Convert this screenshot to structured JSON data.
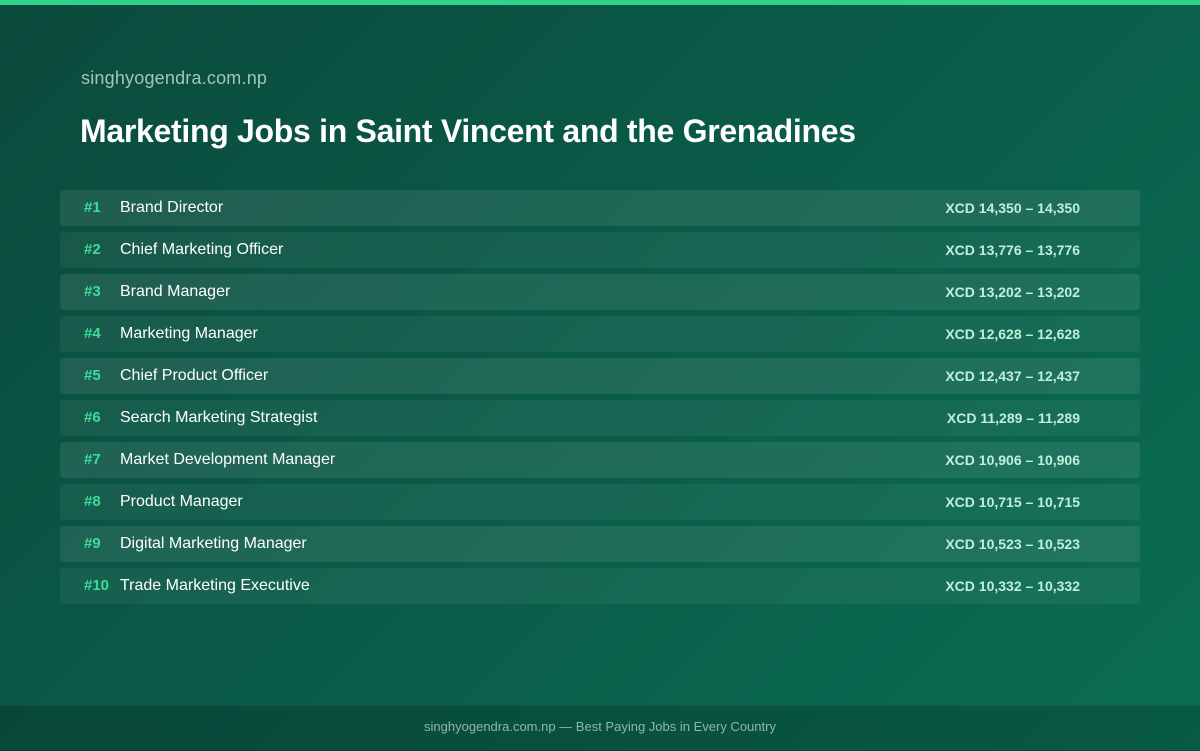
{
  "header": {
    "site": "singhyogendra.com.np",
    "title": "Marketing Jobs in Saint Vincent and the Grenadines"
  },
  "jobs": [
    {
      "rank": "#1",
      "title": "Brand Director",
      "salary": "XCD 14,350 – 14,350"
    },
    {
      "rank": "#2",
      "title": "Chief Marketing Officer",
      "salary": "XCD 13,776 – 13,776"
    },
    {
      "rank": "#3",
      "title": "Brand Manager",
      "salary": "XCD 13,202 – 13,202"
    },
    {
      "rank": "#4",
      "title": "Marketing Manager",
      "salary": "XCD 12,628 – 12,628"
    },
    {
      "rank": "#5",
      "title": "Chief Product Officer",
      "salary": "XCD 12,437 – 12,437"
    },
    {
      "rank": "#6",
      "title": "Search Marketing Strategist",
      "salary": "XCD 11,289 – 11,289"
    },
    {
      "rank": "#7",
      "title": "Market Development Manager",
      "salary": "XCD 10,906 – 10,906"
    },
    {
      "rank": "#8",
      "title": "Product Manager",
      "salary": "XCD 10,715 – 10,715"
    },
    {
      "rank": "#9",
      "title": "Digital Marketing Manager",
      "salary": "XCD 10,523 – 10,523"
    },
    {
      "rank": "#10",
      "title": "Trade Marketing Executive",
      "salary": "XCD 10,332 – 10,332"
    }
  ],
  "footer": {
    "text": "singhyogendra.com.np — Best Paying Jobs in Every Country"
  },
  "colors": {
    "accent": "#2fd28c",
    "rank": "#3ddc98",
    "salary": "#bff0da",
    "background": "#0a5a47"
  }
}
